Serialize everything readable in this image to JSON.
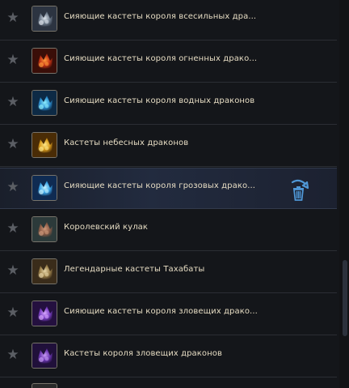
{
  "items": [
    {
      "label": "Сияющие кастеты короля всесильных дра...",
      "icon": "silver-dragon-knuckles-icon",
      "colors": [
        "#dfe6ee",
        "#6f7c8c",
        "#2c3441"
      ]
    },
    {
      "label": "Сияющие кастеты короля огненных драко...",
      "icon": "fire-dragon-knuckles-icon",
      "colors": [
        "#ff9a3a",
        "#c23214",
        "#3a0e08"
      ]
    },
    {
      "label": "Сияющие кастеты короля водных драконов",
      "icon": "water-dragon-knuckles-icon",
      "colors": [
        "#8ff0ff",
        "#2c8ed0",
        "#0d2a45"
      ]
    },
    {
      "label": "Кастеты небесных драконов",
      "icon": "sky-dragon-knuckles-icon",
      "colors": [
        "#ffe98a",
        "#d79a1c",
        "#4a2c06"
      ]
    },
    {
      "label": "Сияющие кастеты короля грозовых драко...",
      "icon": "storm-dragon-knuckles-icon",
      "colors": [
        "#c9f4ff",
        "#3aa5e8",
        "#0f2b52"
      ]
    },
    {
      "label": "Королевский кулак",
      "icon": "royal-fist-icon",
      "colors": [
        "#d09a7c",
        "#8a5a45",
        "#2c3a3a"
      ]
    },
    {
      "label": "Легендарные кастеты Тахабаты",
      "icon": "tahabata-knuckles-icon",
      "colors": [
        "#e8d7a8",
        "#9a7f4a",
        "#3a2c1a"
      ]
    },
    {
      "label": "Сияющие кастеты короля зловещих драко...",
      "icon": "sinister-dragon-knuckles-icon",
      "colors": [
        "#d8a8ff",
        "#7a3fc4",
        "#24103f"
      ]
    },
    {
      "label": "Кастеты короля зловещих драконов",
      "icon": "sinister-dragon-knuckles-icon",
      "colors": [
        "#c79bf5",
        "#6a35b0",
        "#20103a"
      ]
    }
  ],
  "highlight_index": 4,
  "accent": "#e6dcc3",
  "trash_icon_color": "#4f97d6"
}
